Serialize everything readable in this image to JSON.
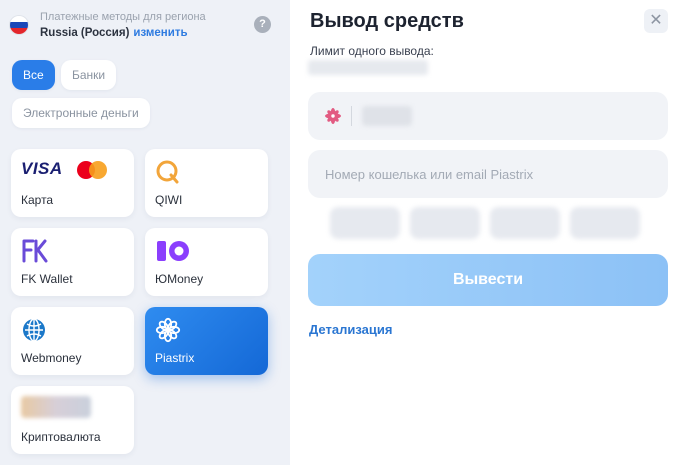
{
  "region": {
    "title": "Платежные методы для региона",
    "country": "Russia (Россия)",
    "change_label": "изменить",
    "help_label": "?"
  },
  "filters": [
    {
      "label": "Все",
      "active": true
    },
    {
      "label": "Банки",
      "active": false
    },
    {
      "label": "Электронные деньги",
      "active": false
    }
  ],
  "methods": [
    {
      "label": "Карта",
      "icon": "visa-mastercard-icon",
      "brand_text": "VISA"
    },
    {
      "label": "QIWI",
      "icon": "qiwi-icon"
    },
    {
      "label": "FK Wallet",
      "icon": "fk-wallet-icon"
    },
    {
      "label": "ЮMoney",
      "icon": "yumoney-icon"
    },
    {
      "label": "Webmoney",
      "icon": "webmoney-icon"
    },
    {
      "label": "Piastrix",
      "icon": "piastrix-icon",
      "active": true
    },
    {
      "label": "Криптовалюта",
      "icon": "crypto-icon"
    }
  ],
  "withdraw": {
    "title": "Вывод средств",
    "close_label": "✕",
    "limit_label": "Лимит одного вывода:",
    "wallet_placeholder": "Номер кошелька или email Piastrix",
    "submit_label": "Вывести",
    "details_label": "Детализация"
  },
  "colors": {
    "accent": "#2a7de8",
    "submit_disabled": "#98cbf8",
    "link": "#2a76d2",
    "panel_bg": "#eef1f7"
  }
}
